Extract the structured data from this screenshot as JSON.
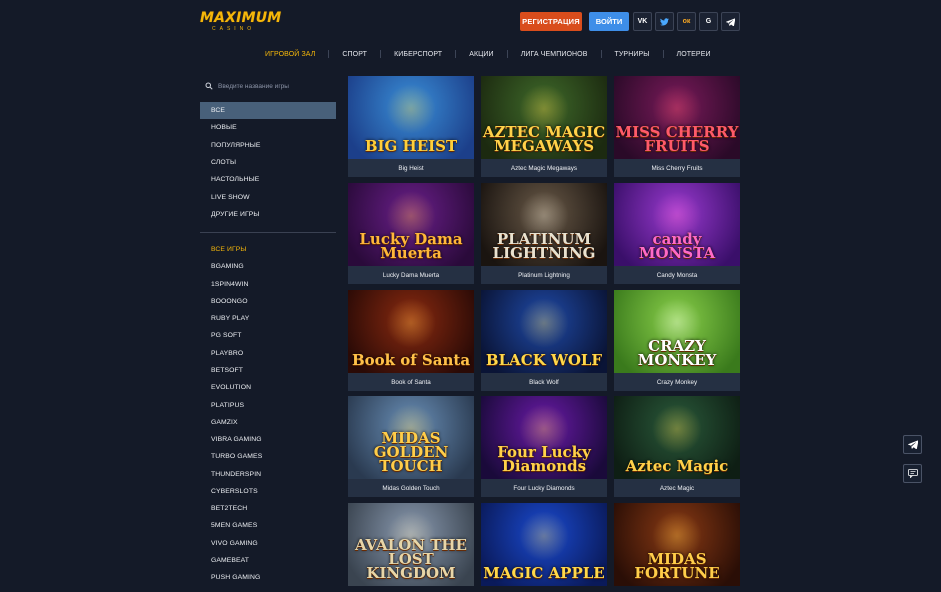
{
  "header": {
    "logo_word": "MAXIMUM",
    "logo_sub": "CASINO",
    "register_label": "РЕГИСТРАЦИЯ",
    "login_label": "ВОЙТИ",
    "socials": [
      {
        "name": "vk-icon",
        "glyph": "VK"
      },
      {
        "name": "twitter-icon",
        "glyph": ""
      },
      {
        "name": "odnoklassniki-icon",
        "glyph": "ок"
      },
      {
        "name": "google-icon",
        "glyph": "G"
      },
      {
        "name": "telegram-icon",
        "glyph": ""
      }
    ]
  },
  "nav": [
    "ИГРОВОЙ ЗАЛ",
    "СПОРТ",
    "КИБЕРСПОРТ",
    "АКЦИИ",
    "ЛИГА ЧЕМПИОНОВ",
    "ТУРНИРЫ",
    "ЛОТЕРЕИ"
  ],
  "search": {
    "placeholder": "Введите название игры"
  },
  "categories": [
    "ВСЕ",
    "НОВЫЕ",
    "ПОПУЛЯРНЫЕ",
    "СЛОТЫ",
    "НАСТОЛЬНЫЕ",
    "LIVE SHOW",
    "ДРУГИЕ ИГРЫ"
  ],
  "providers": [
    "ВСЕ ИГРЫ",
    "BGAMING",
    "1SPIN4WIN",
    "BOOONGO",
    "RUBY PLAY",
    "PG SOFT",
    "PLAYBRO",
    "BETSOFT",
    "EVOLUTION",
    "PLATIPUS",
    "GAMZIX",
    "VIBRA GAMING",
    "TURBO GAMES",
    "THUNDERSPIN",
    "CYBERSLOTS",
    "BET2TECH",
    "5MEN GAMES",
    "VIVO GAMING",
    "GAMEBEAT",
    "PUSH GAMING"
  ],
  "games": [
    {
      "name": "Big Heist",
      "art": "BIG HEIST",
      "bg1": "#3a8fd8",
      "bg2": "#1c3f8a",
      "accent": "#ffcf3a"
    },
    {
      "name": "Aztec Magic Megaways",
      "art": "AZTEC MAGIC MEGAWAYS",
      "bg1": "#3f6a2a",
      "bg2": "#1c2a10",
      "accent": "#ffd24a"
    },
    {
      "name": "Miss Cherry Fruits",
      "art": "MISS CHERRY FRUITS",
      "bg1": "#7a1a5a",
      "bg2": "#2a0a28",
      "accent": "#ff5a6a"
    },
    {
      "name": "Lucky Dama Muerta",
      "art": "Lucky Dama Muerta",
      "bg1": "#6a1f8a",
      "bg2": "#2a0a3a",
      "accent": "#ffb83a"
    },
    {
      "name": "Platinum Lightning",
      "art": "PLATINUM LIGHTNING",
      "bg1": "#6a5a48",
      "bg2": "#1a1410",
      "accent": "#e8e2d0"
    },
    {
      "name": "Candy Monsta",
      "art": "candy MONSTA",
      "bg1": "#9a3ad0",
      "bg2": "#3a0f6a",
      "accent": "#ff6ac8"
    },
    {
      "name": "Book of Santa",
      "art": "Book of Santa",
      "bg1": "#8a2a10",
      "bg2": "#2a0a06",
      "accent": "#ffc24a"
    },
    {
      "name": "Black Wolf",
      "art": "BLACK WOLF",
      "bg1": "#1f4aa8",
      "bg2": "#0a1436",
      "accent": "#ffd84a"
    },
    {
      "name": "Crazy Monkey",
      "art": "CRAZY MONKEY",
      "bg1": "#8ad04a",
      "bg2": "#3a7a1c",
      "accent": "#ffffff"
    },
    {
      "name": "Midas Golden Touch",
      "art": "MIDAS GOLDEN TOUCH",
      "bg1": "#6a90b8",
      "bg2": "#2a3a50",
      "accent": "#ffce4a"
    },
    {
      "name": "Four Lucky Diamonds",
      "art": "Four Lucky Diamonds",
      "bg1": "#6a1aa8",
      "bg2": "#1a0a3a",
      "accent": "#ffd24a"
    },
    {
      "name": "Aztec Magic",
      "art": "Aztec Magic",
      "bg1": "#2a5a3a",
      "bg2": "#0e1e14",
      "accent": "#ffd24a"
    },
    {
      "name": "",
      "art": "AVALON THE LOST KINGDOM",
      "bg1": "#8a9ab0",
      "bg2": "#3a4450",
      "accent": "#e8d6a8"
    },
    {
      "name": "",
      "art": "MAGIC APPLE",
      "bg1": "#1a4ad0",
      "bg2": "#0a1a5a",
      "accent": "#ffd84a"
    },
    {
      "name": "",
      "art": "MIDAS FORTUNE",
      "bg1": "#8a3a14",
      "bg2": "#2a0e06",
      "accent": "#ffce4a"
    }
  ],
  "colors": {
    "background": "#141a28",
    "accent_yellow": "#f5b70a",
    "register_bg": "#d94d1c",
    "login_bg": "#3e8ee8",
    "active_category_bg": "#48607a",
    "caption_bg": "#253043"
  }
}
